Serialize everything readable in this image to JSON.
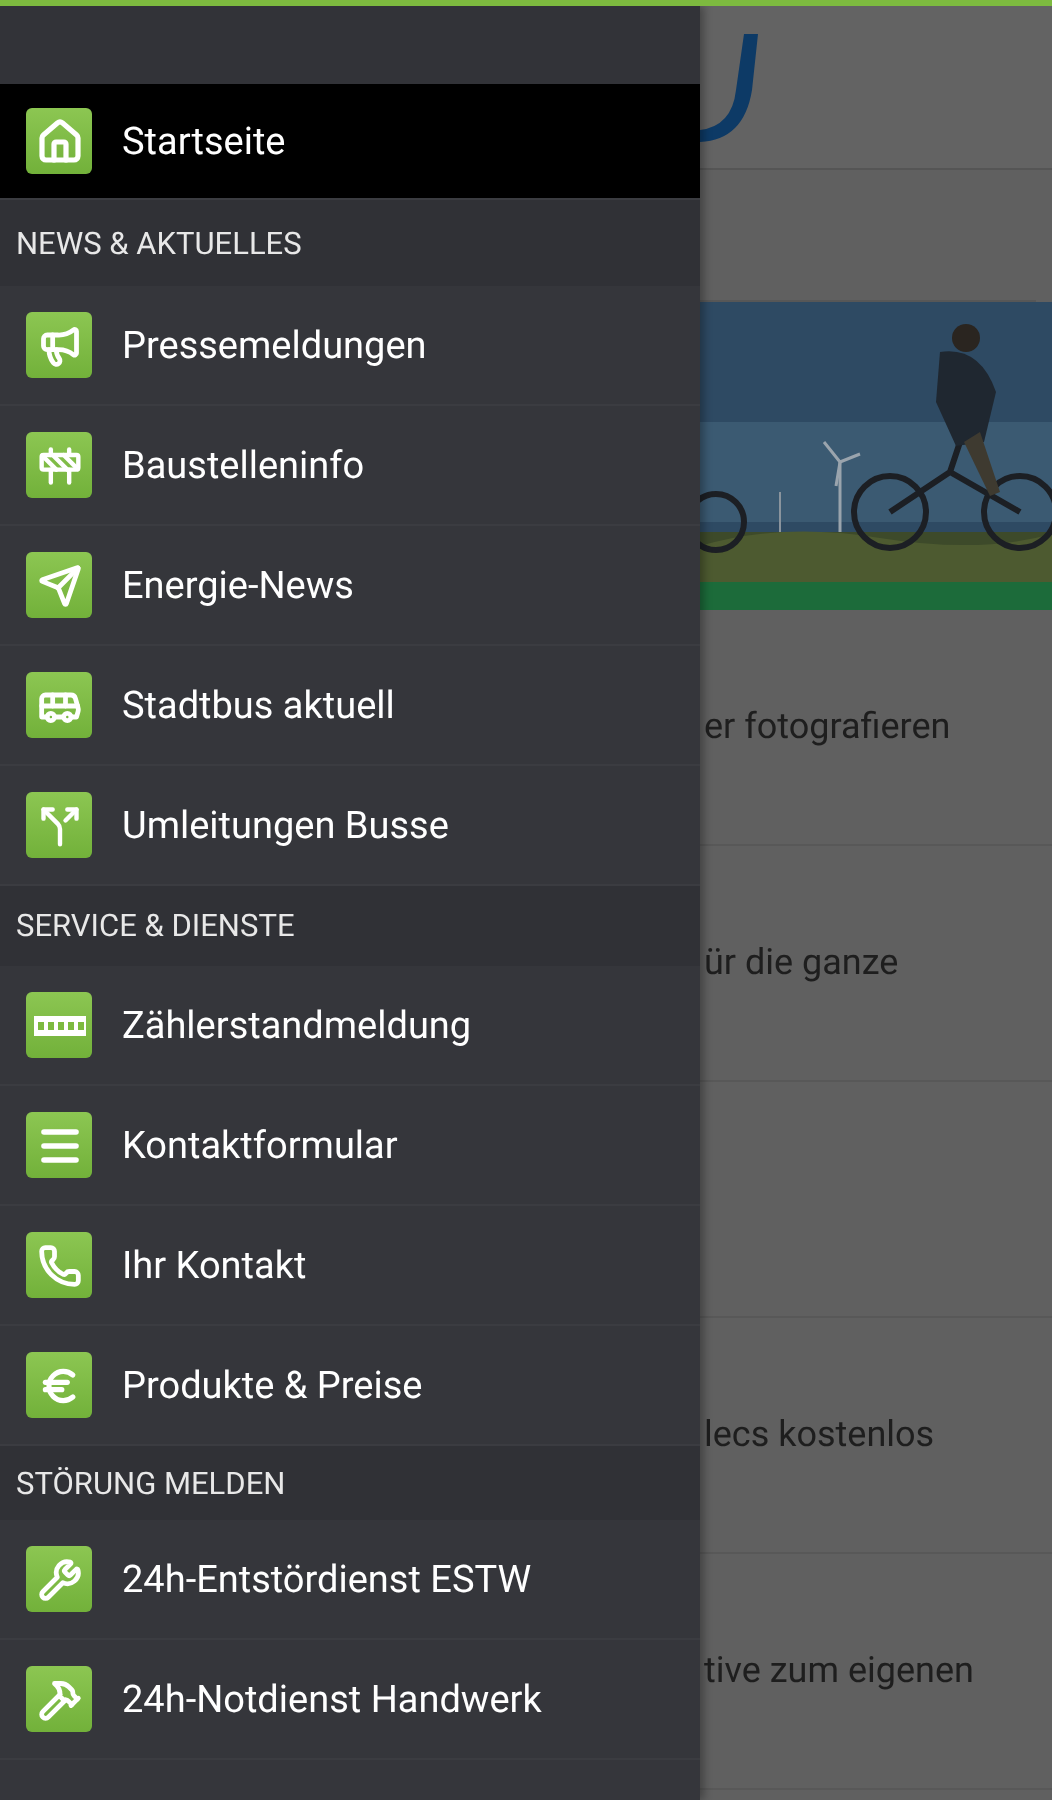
{
  "drawer": {
    "items": [
      {
        "kind": "item",
        "label": "Startseite",
        "selected": true
      },
      {
        "kind": "header",
        "label": "NEWS & AKTUELLES"
      },
      {
        "kind": "item",
        "label": "Pressemeldungen",
        "selected": false
      },
      {
        "kind": "item",
        "label": "Baustelleninfo",
        "selected": false
      },
      {
        "kind": "item",
        "label": "Energie-News",
        "selected": false
      },
      {
        "kind": "item",
        "label": "Stadtbus aktuell",
        "selected": false
      },
      {
        "kind": "item",
        "label": "Umleitungen Busse",
        "selected": false
      },
      {
        "kind": "header",
        "label": "SERVICE & DIENSTE"
      },
      {
        "kind": "item",
        "label": "Zählerstandmeldung",
        "selected": false
      },
      {
        "kind": "item",
        "label": "Kontaktformular",
        "selected": false
      },
      {
        "kind": "item",
        "label": "Ihr Kontakt",
        "selected": false
      },
      {
        "kind": "item",
        "label": "Produkte & Preise",
        "selected": false
      },
      {
        "kind": "header",
        "label": "STÖRUNG MELDEN"
      },
      {
        "kind": "item",
        "label": "24h-Entstördienst ESTW",
        "selected": false
      },
      {
        "kind": "item",
        "label": "24h-Notdienst Handwerk",
        "selected": false
      }
    ]
  },
  "content": {
    "rows": [
      "er fotografieren",
      "ür die ganze",
      "",
      "lecs kostenlos",
      "tive zum eigenen"
    ]
  }
}
